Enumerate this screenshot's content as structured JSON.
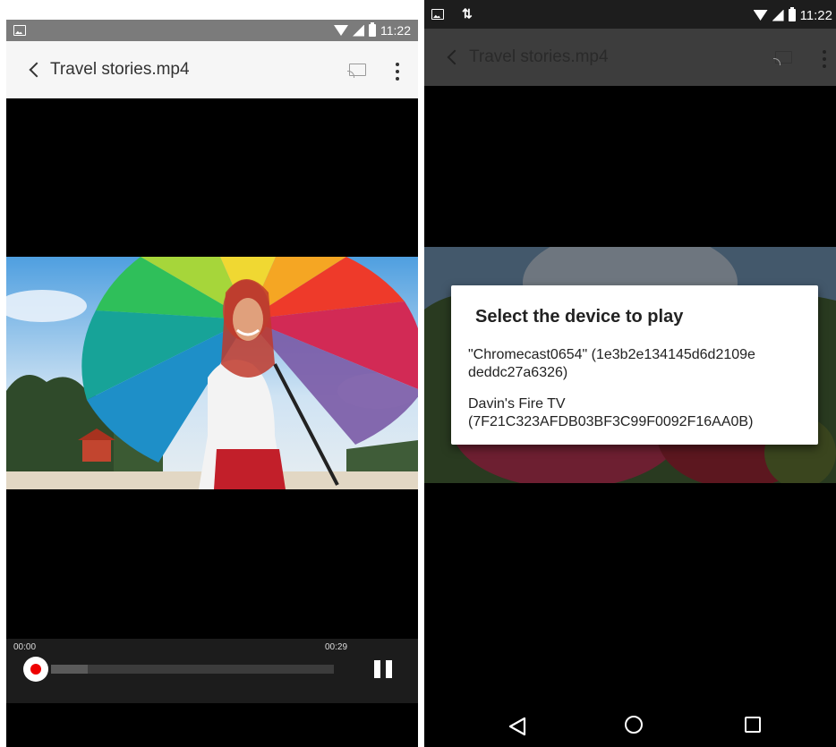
{
  "left_screen": {
    "status_bar": {
      "time": "11:22",
      "icons": [
        "image-icon",
        "wifi-icon",
        "signal-icon",
        "battery-icon"
      ]
    },
    "app_bar": {
      "title": "Travel stories.mp4",
      "icons": [
        "back-icon",
        "cast-icon",
        "more-icon"
      ]
    },
    "player": {
      "current_time": "00:00",
      "duration": "00:29",
      "buffered_fraction": 0.13,
      "played_fraction": 0.0,
      "state_icon": "pause-icon"
    }
  },
  "right_screen": {
    "status_bar": {
      "time": "11:22",
      "icons": [
        "image-icon",
        "data-arrows-icon",
        "wifi-icon",
        "signal-icon",
        "battery-icon"
      ]
    },
    "app_bar": {
      "title": "Travel stories.mp4"
    },
    "dialog": {
      "title": "Select the device to play",
      "devices": [
        {
          "line1": "\"Chromecast0654\" (1e3b2e134145d6d2109e",
          "line2": "deddc27a6326)"
        },
        {
          "line1": "Davin's Fire TV",
          "line2": "(7F21C323AFDB03BF3C99F0092F16AA0B)"
        }
      ]
    },
    "nav_bar": {
      "icons": [
        "back-triangle-icon",
        "home-circle-icon",
        "recents-square-icon"
      ]
    }
  },
  "colors": {
    "status_bar": "#7b7b7b",
    "app_bar": "#f6f6f6",
    "accent": "#e00000",
    "dialog_bg": "#ffffff"
  }
}
